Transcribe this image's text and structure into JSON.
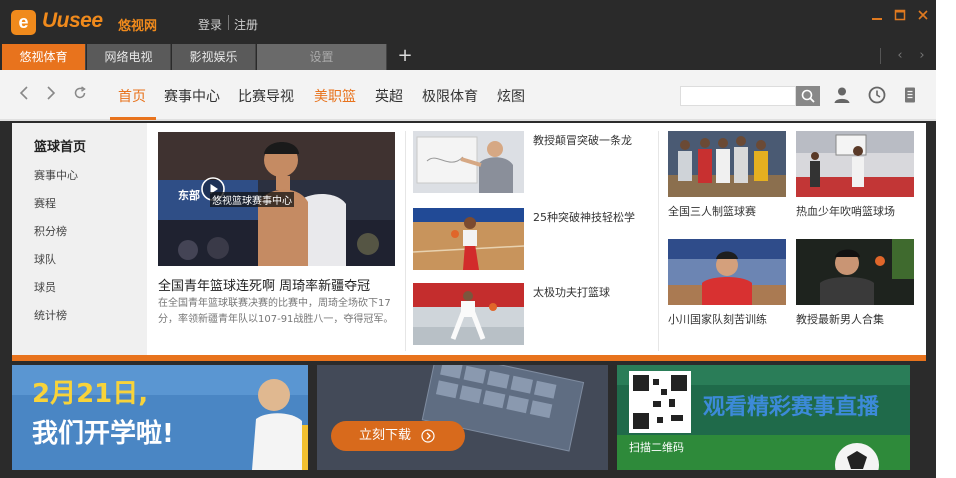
{
  "app": {
    "logo_letter": "e",
    "logo_text": "Uusee",
    "logo_cn": "悠视网",
    "login": "登录",
    "register": "注册"
  },
  "tabs": [
    {
      "label": "悠视体育",
      "state": "active"
    },
    {
      "label": "网络电视",
      "state": "normal"
    },
    {
      "label": "影视娱乐",
      "state": "normal"
    },
    {
      "label": "设置",
      "state": "disabled"
    }
  ],
  "nav": {
    "menu": [
      "首页",
      "赛事中心",
      "比赛导视",
      "美职篮",
      "英超",
      "极限体育",
      "炫图"
    ],
    "active_index": 0,
    "search_placeholder": ""
  },
  "sidebar": {
    "title": "篮球首页",
    "items": [
      "赛事中心",
      "赛程",
      "积分榜",
      "球队",
      "球员",
      "统计榜"
    ]
  },
  "featured": {
    "overlay_label": "悠视篮球赛事中心",
    "jersey_text": "东部",
    "title": "全国青年篮球连死啊 周琦率新疆夺冠",
    "description": "在全国青年篮球联赛决赛的比赛中，周琦全场砍下17分，率领新疆青年队以107-91战胜八一，夺得冠军。"
  },
  "middle_videos": [
    {
      "title": "教授颠冒突破一条龙"
    },
    {
      "title": "25种突破神技轻松学"
    },
    {
      "title": "太极功夫打篮球"
    }
  ],
  "grid_videos": [
    {
      "title": "全国三人制篮球赛"
    },
    {
      "title": "热血少年吹哨篮球场"
    },
    {
      "title": "小川国家队刻苦训练"
    },
    {
      "title": "教授最新男人合集"
    }
  ],
  "banners": [
    {
      "headline_date": "2月21日,",
      "headline": "我们开学啦!"
    },
    {
      "button": "立刻下载"
    },
    {
      "headline": "观看精彩赛事直播",
      "caption": "扫描二维码"
    }
  ],
  "colors": {
    "accent": "#e8731d",
    "titlebar": "#2a2a2a",
    "navbar": "#f3f3f3"
  }
}
